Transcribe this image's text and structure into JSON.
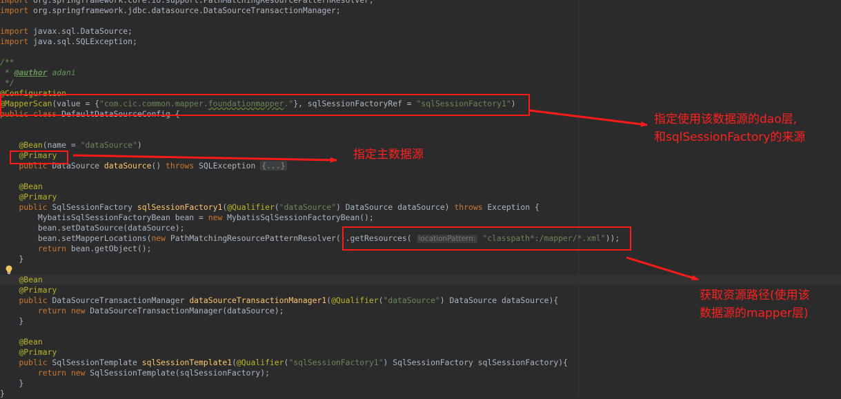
{
  "code_lines": [
    [
      {
        "t": "import",
        "c": "kw"
      },
      {
        "t": " org.springframework.core.io.support.PathMatchingResourcePatternResolver;"
      }
    ],
    [
      {
        "t": "import",
        "c": "kw"
      },
      {
        "t": " org.springframework.jdbc.datasource.DataSourceTransactionManager;"
      }
    ],
    [],
    [
      {
        "t": "import",
        "c": "kw"
      },
      {
        "t": " javax.sql.DataSource;"
      }
    ],
    [
      {
        "t": "import",
        "c": "kw"
      },
      {
        "t": " java.sql.SQLException;"
      }
    ],
    [],
    [
      {
        "t": "/**",
        "c": "cmt"
      }
    ],
    [
      {
        "t": " * ",
        "c": "cmt"
      },
      {
        "t": "@author",
        "c": "doc-tag"
      },
      {
        "t": " adani",
        "c": "cmt"
      }
    ],
    [
      {
        "t": " */",
        "c": "cmt"
      }
    ],
    [
      {
        "t": "@Configuration",
        "c": "ann"
      }
    ],
    [
      {
        "t": "@MapperScan",
        "c": "ann"
      },
      {
        "t": "(value = {"
      },
      {
        "t": "\"com.cic.common.mapper.",
        "c": "str"
      },
      {
        "t": "foundationmapper",
        "c": "str squig"
      },
      {
        "t": ".\"",
        "c": "str"
      },
      {
        "t": "}, sqlSessionFactoryRef = "
      },
      {
        "t": "\"sqlSessionFactory1\"",
        "c": "str"
      },
      {
        "t": ")"
      }
    ],
    [
      {
        "t": "public class",
        "c": "kw"
      },
      {
        "t": " DefaultDataSourceConfig {"
      }
    ],
    [],
    [],
    [
      {
        "t": "    "
      },
      {
        "t": "@Bean",
        "c": "ann"
      },
      {
        "t": "(name = "
      },
      {
        "t": "\"dataSource\"",
        "c": "str"
      },
      {
        "t": ")"
      }
    ],
    [
      {
        "t": "    "
      },
      {
        "t": "@Primary",
        "c": "ann"
      }
    ],
    [
      {
        "t": "    "
      },
      {
        "t": "public",
        "c": "kw"
      },
      {
        "t": " DataSource "
      },
      {
        "t": "dataSource",
        "c": "meth"
      },
      {
        "t": "() "
      },
      {
        "t": "throws",
        "c": "kw"
      },
      {
        "t": " SQLException "
      },
      {
        "t": "{...}",
        "c": "fold"
      }
    ],
    [],
    [
      {
        "t": "    "
      },
      {
        "t": "@Bean",
        "c": "ann"
      }
    ],
    [
      {
        "t": "    "
      },
      {
        "t": "@Primary",
        "c": "ann"
      }
    ],
    [
      {
        "t": "    "
      },
      {
        "t": "public",
        "c": "kw"
      },
      {
        "t": " SqlSessionFactory "
      },
      {
        "t": "sqlSessionFactory1",
        "c": "meth"
      },
      {
        "t": "("
      },
      {
        "t": "@Qualifier",
        "c": "ann"
      },
      {
        "t": "("
      },
      {
        "t": "\"dataSource\"",
        "c": "str"
      },
      {
        "t": ") DataSource dataSource) "
      },
      {
        "t": "throws",
        "c": "kw"
      },
      {
        "t": " Exception {"
      }
    ],
    [
      {
        "t": "        MybatisSqlSessionFactoryBean bean = "
      },
      {
        "t": "new",
        "c": "kw"
      },
      {
        "t": " MybatisSqlSessionFactoryBean();"
      }
    ],
    [
      {
        "t": "        bean.setDataSource(dataSource);"
      }
    ],
    [
      {
        "t": "        bean.setMapperLocations("
      },
      {
        "t": "new",
        "c": "kw"
      },
      {
        "t": " PathMatchingResourcePatternResolver().getResources( "
      },
      {
        "t": "locationPattern:",
        "c": "hint"
      },
      {
        "t": " "
      },
      {
        "t": "\"classpath*:/mapper/*.xml\"",
        "c": "str"
      },
      {
        "t": "));"
      }
    ],
    [
      {
        "t": "        "
      },
      {
        "t": "return",
        "c": "kw"
      },
      {
        "t": " bean.getObject();"
      }
    ],
    [
      {
        "t": "    }"
      }
    ],
    [],
    [
      {
        "t": "    "
      },
      {
        "t": "@Bean",
        "c": "ann"
      }
    ],
    [
      {
        "t": "    "
      },
      {
        "t": "@Primary",
        "c": "ann"
      }
    ],
    [
      {
        "t": "    "
      },
      {
        "t": "public",
        "c": "kw"
      },
      {
        "t": " DataSourceTransactionManager "
      },
      {
        "t": "dataSourceTransactionManager1",
        "c": "meth"
      },
      {
        "t": "("
      },
      {
        "t": "@Qualifier",
        "c": "ann"
      },
      {
        "t": "("
      },
      {
        "t": "\"dataSource\"",
        "c": "str"
      },
      {
        "t": ") DataSource dataSource){"
      }
    ],
    [
      {
        "t": "        "
      },
      {
        "t": "return new",
        "c": "kw"
      },
      {
        "t": " DataSourceTransactionManager(dataSource);"
      }
    ],
    [
      {
        "t": "    }"
      }
    ],
    [],
    [
      {
        "t": "    "
      },
      {
        "t": "@Bean",
        "c": "ann"
      }
    ],
    [
      {
        "t": "    "
      },
      {
        "t": "@Primary",
        "c": "ann"
      }
    ],
    [
      {
        "t": "    "
      },
      {
        "t": "public",
        "c": "kw"
      },
      {
        "t": " SqlSessionTemplate "
      },
      {
        "t": "sqlSessionTemplate1",
        "c": "meth"
      },
      {
        "t": "("
      },
      {
        "t": "@Qualifier",
        "c": "ann"
      },
      {
        "t": "("
      },
      {
        "t": "\"sqlSessionFactory1\"",
        "c": "str"
      },
      {
        "t": ") SqlSessionFactory sqlSessionFactory){"
      }
    ],
    [
      {
        "t": "        "
      },
      {
        "t": "return new",
        "c": "kw"
      },
      {
        "t": " SqlSessionTemplate(sqlSessionFactory);"
      }
    ],
    [
      {
        "t": "    }"
      }
    ],
    [
      {
        "t": "}"
      }
    ]
  ],
  "annotations": {
    "mapper_scan_note": "指定使用该数据源的dao层,\n和sqlSessionFactory的来源",
    "primary_note": "指定主数据源",
    "resource_path_note": "获取资源路径(使用该\n数据源的mapper层)"
  },
  "colors": {
    "background": "#2b2b2b",
    "keyword": "#cc7832",
    "annotation": "#bbb529",
    "string": "#6a8759",
    "method": "#ffc66d",
    "markup_red": "#ff1a1a"
  },
  "icons": {
    "gutter": "lightbulb-icon"
  }
}
